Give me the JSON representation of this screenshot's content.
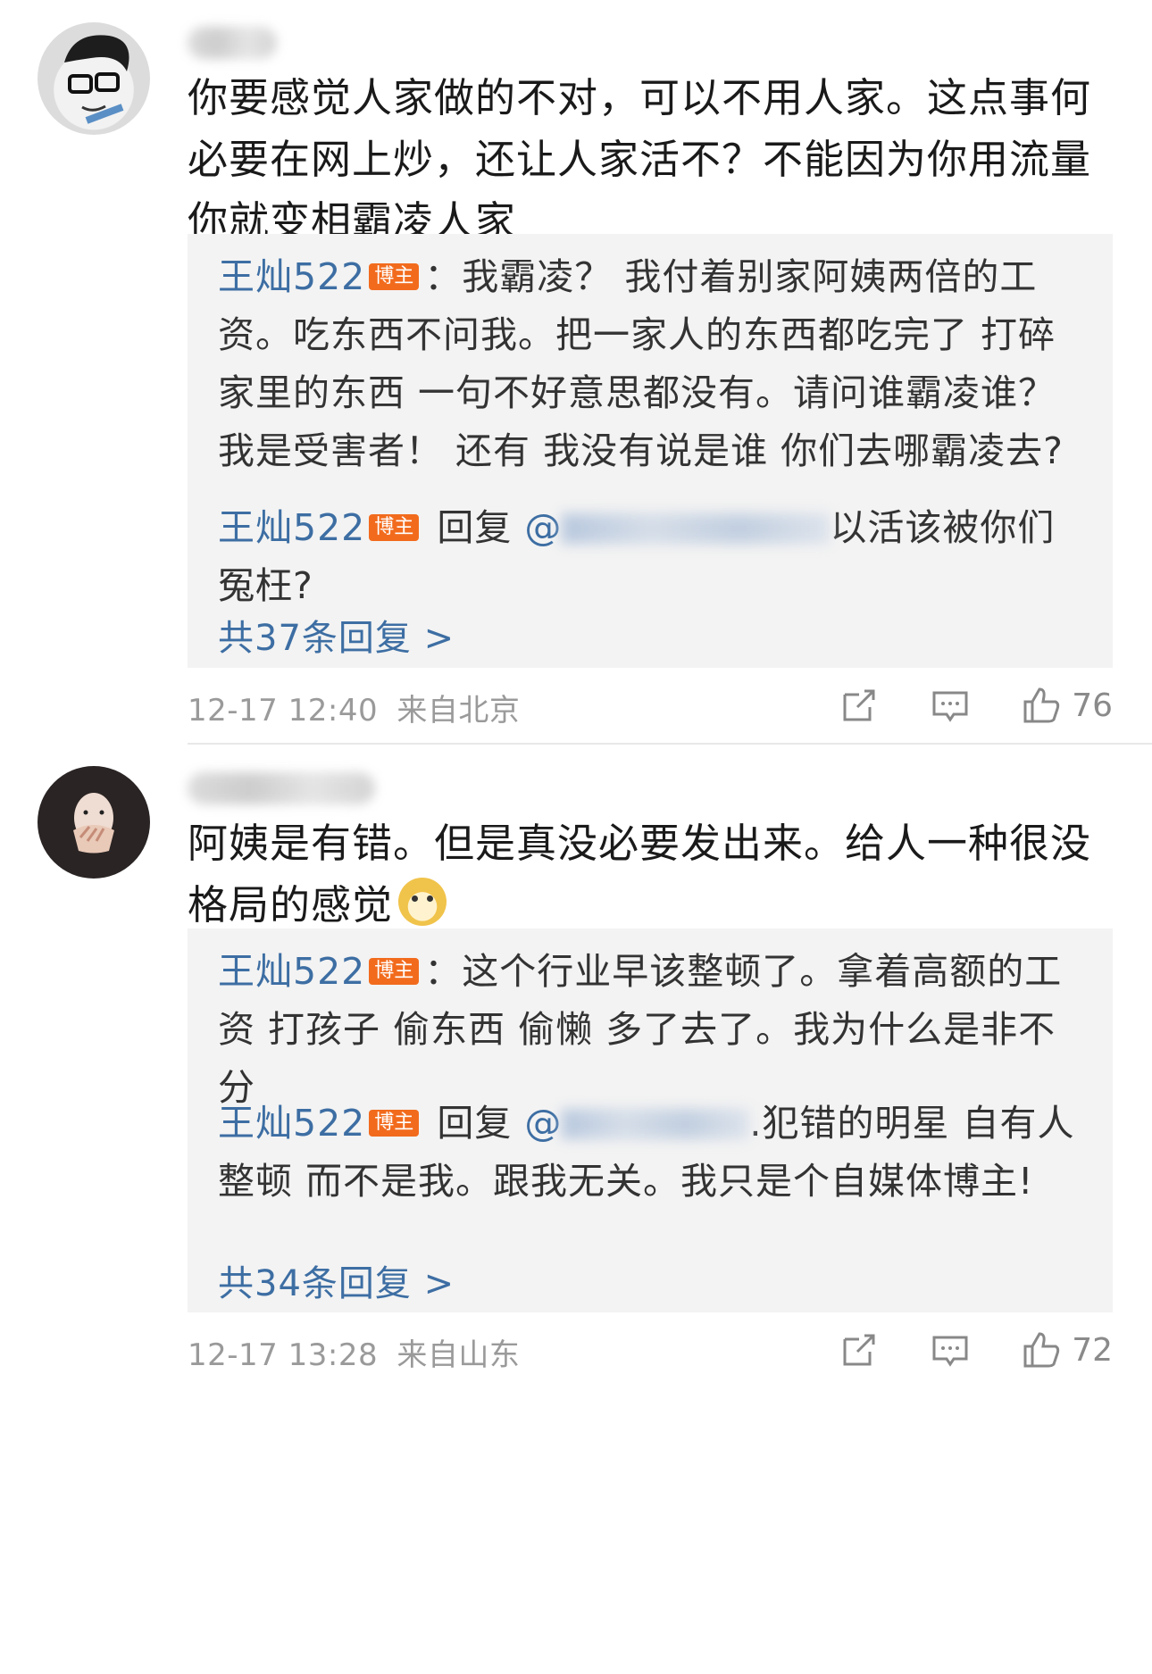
{
  "comments": [
    {
      "text": "你要感觉人家做的不对，可以不用人家。这点事何必要在网上炒，还让人家活不？不能因为你用流量你就变相霸凌人家",
      "replies": [
        {
          "author": "王灿522",
          "badge": "博主",
          "prefix": "：",
          "text": "我霸凌？ 我付着别家阿姨两倍的工资。吃东西不问我。把一家人的东西都吃完了 打碎家里的东西 一句不好意思都没有。请问谁霸凌谁？ 我是受害者！ 还有 我没有说是谁 你们去哪霸凌去?"
        },
        {
          "author": "王灿522",
          "badge": "博主",
          "reply_word": "回复",
          "mention_start": "@",
          "text": "以活该被你们冤枉?"
        }
      ],
      "more_replies": "共37条回复 >",
      "time": "12-17 12:40",
      "location": "来自北京",
      "likes": "76"
    },
    {
      "text": "阿姨是有错。但是真没必要发出来。给人一种很没格局的感觉",
      "emoji": "doge-emoji",
      "replies": [
        {
          "author": "王灿522",
          "badge": "博主",
          "prefix": "：",
          "text": "这个行业早该整顿了。拿着高额的工资 打孩子 偷东西 偷懒 多了去了。我为什么是非不分"
        },
        {
          "author": "王灿522",
          "badge": "博主",
          "reply_word": "回复",
          "mention_start": "@",
          "text": ".犯错的明星 自有人整顿 而不是我。跟我无关。我只是个自媒体博主!"
        }
      ],
      "more_replies": "共34条回复 >",
      "time": "12-17 13:28",
      "location": "来自山东",
      "likes": "72"
    }
  ],
  "icons": {
    "share": "share-icon",
    "comment": "comment-icon",
    "like": "like-icon"
  },
  "colors": {
    "link": "#3d6ea3",
    "badge": "#f26b1d",
    "reply_bg": "#f3f3f3",
    "meta": "#9a9a9a"
  }
}
